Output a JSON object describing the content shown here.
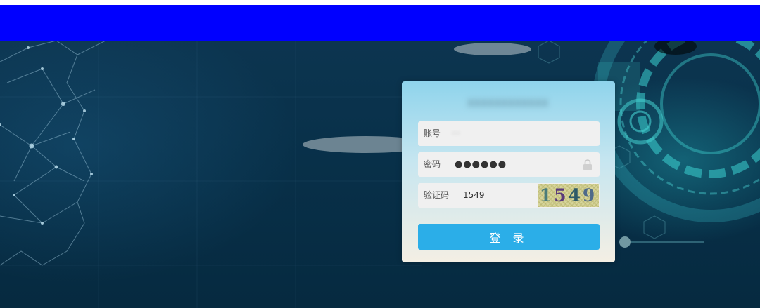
{
  "login": {
    "title": "XXXXXXXXXXXX",
    "account_label": "账号",
    "account_value": "···",
    "password_label": "密码",
    "password_value": "●●●●●●",
    "captcha_label": "验证码",
    "captcha_value": "1549",
    "captcha_image_text": [
      "1",
      "5",
      "4",
      "9"
    ],
    "submit_label": "登 录",
    "colors": {
      "header": "#0000ff",
      "button": "#2baee8"
    }
  }
}
